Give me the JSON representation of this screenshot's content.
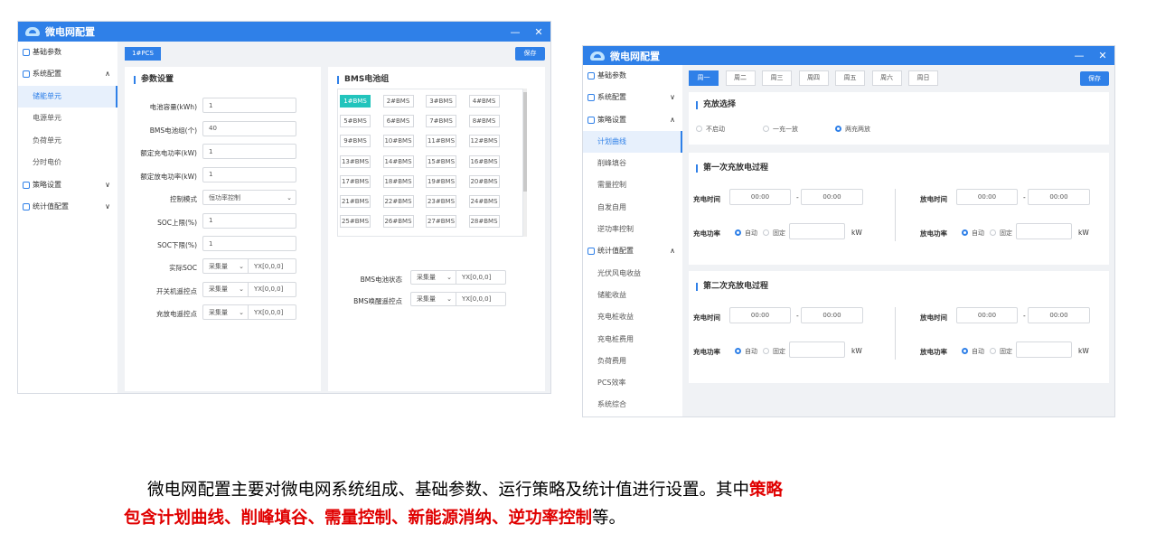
{
  "w1": {
    "title": "微电网配置",
    "min": "—",
    "close": "✕",
    "side": [
      {
        "label": "基础参数",
        "chev": ""
      },
      {
        "label": "系统配置",
        "chev": "∧"
      },
      {
        "label": "储能单元",
        "chev": ""
      },
      {
        "label": "电源单元",
        "chev": ""
      },
      {
        "label": "负荷单元",
        "chev": ""
      },
      {
        "label": "分时电价",
        "chev": ""
      },
      {
        "label": "策略设置",
        "chev": "∨"
      },
      {
        "label": "统计值配置",
        "chev": "∨"
      }
    ],
    "tab": "1#PCS",
    "save": "保存",
    "param_title": "参数设置",
    "fields": [
      {
        "label": "电池容量(kWh)",
        "value": "1"
      },
      {
        "label": "BMS电池组(个)",
        "value": "40"
      },
      {
        "label": "额定充电功率(kW)",
        "value": "1"
      },
      {
        "label": "额定放电功率(kW)",
        "value": "1"
      },
      {
        "label": "控制模式",
        "value": "恒功率控制"
      },
      {
        "label": "SOC上限(%)",
        "value": "1"
      },
      {
        "label": "SOC下限(%)",
        "value": "1"
      }
    ],
    "points": [
      {
        "label": "实际SOC",
        "sel": "采集量",
        "val": "YX[0,0,0]"
      },
      {
        "label": "开关机遥控点",
        "sel": "采集量",
        "val": "YX[0,0,0]"
      },
      {
        "label": "充放电遥控点",
        "sel": "采集量",
        "val": "YX[0,0,0]"
      }
    ],
    "bms_title": "BMS电池组",
    "bms": [
      "1#BMS",
      "2#BMS",
      "3#BMS",
      "4#BMS",
      "5#BMS",
      "6#BMS",
      "7#BMS",
      "8#BMS",
      "9#BMS",
      "10#BMS",
      "11#BMS",
      "12#BMS",
      "13#BMS",
      "14#BMS",
      "15#BMS",
      "16#BMS",
      "17#BMS",
      "18#BMS",
      "19#BMS",
      "20#BMS",
      "21#BMS",
      "22#BMS",
      "23#BMS",
      "24#BMS",
      "25#BMS",
      "26#BMS",
      "27#BMS",
      "28#BMS"
    ],
    "bms_points": [
      {
        "label": "BMS电池状态",
        "sel": "采集量",
        "val": "YX[0,0,0]"
      },
      {
        "label": "BMS唤醒遥控点",
        "sel": "采集量",
        "val": "YX[0,0,0]"
      }
    ]
  },
  "w2": {
    "title": "微电网配置",
    "min": "—",
    "close": "✕",
    "side": [
      {
        "label": "基础参数",
        "chev": ""
      },
      {
        "label": "系统配置",
        "chev": "∨"
      },
      {
        "label": "策略设置",
        "chev": "∧"
      },
      {
        "label": "计划曲线",
        "chev": ""
      },
      {
        "label": "削峰填谷",
        "chev": ""
      },
      {
        "label": "需量控制",
        "chev": ""
      },
      {
        "label": "自发自用",
        "chev": ""
      },
      {
        "label": "逆功率控制",
        "chev": ""
      },
      {
        "label": "统计值配置",
        "chev": "∧"
      },
      {
        "label": "光伏风电收益",
        "chev": ""
      },
      {
        "label": "储能收益",
        "chev": ""
      },
      {
        "label": "充电桩收益",
        "chev": ""
      },
      {
        "label": "充电桩费用",
        "chev": ""
      },
      {
        "label": "负荷费用",
        "chev": ""
      },
      {
        "label": "PCS效率",
        "chev": ""
      },
      {
        "label": "系统综合",
        "chev": ""
      }
    ],
    "days": [
      "周一",
      "周二",
      "周三",
      "周四",
      "周五",
      "周六",
      "周日"
    ],
    "save": "保存",
    "mode_title": "充放选择",
    "modes": [
      "不启动",
      "一充一放",
      "两充两放"
    ],
    "proc": [
      {
        "title": "第一次充放电过程",
        "charge_time": "充电时间",
        "t1": "00:00",
        "t2": "00:00",
        "discharge_time": "放电时间",
        "t3": "00:00",
        "t4": "00:00",
        "charge_power": "充电功率",
        "discharge_power": "放电功率",
        "auto": "自动",
        "fixed": "固定",
        "unit": "kW",
        "dash": "-"
      },
      {
        "title": "第二次充放电过程",
        "charge_time": "充电时间",
        "t1": "00:00",
        "t2": "00:00",
        "discharge_time": "放电时间",
        "t3": "00:00",
        "t4": "00:00",
        "charge_power": "充电功率",
        "discharge_power": "放电功率",
        "auto": "自动",
        "fixed": "固定",
        "unit": "kW",
        "dash": "-"
      }
    ]
  },
  "caption": {
    "p1": "微电网配置主要对微电网系统组成、基础参数、运行策略及统计值进行设置。其中",
    "r1": "策略",
    "r2": "包含计划曲线、削峰填谷、需量控制、新能源消纳、逆功率控制",
    "p2": "等。"
  }
}
